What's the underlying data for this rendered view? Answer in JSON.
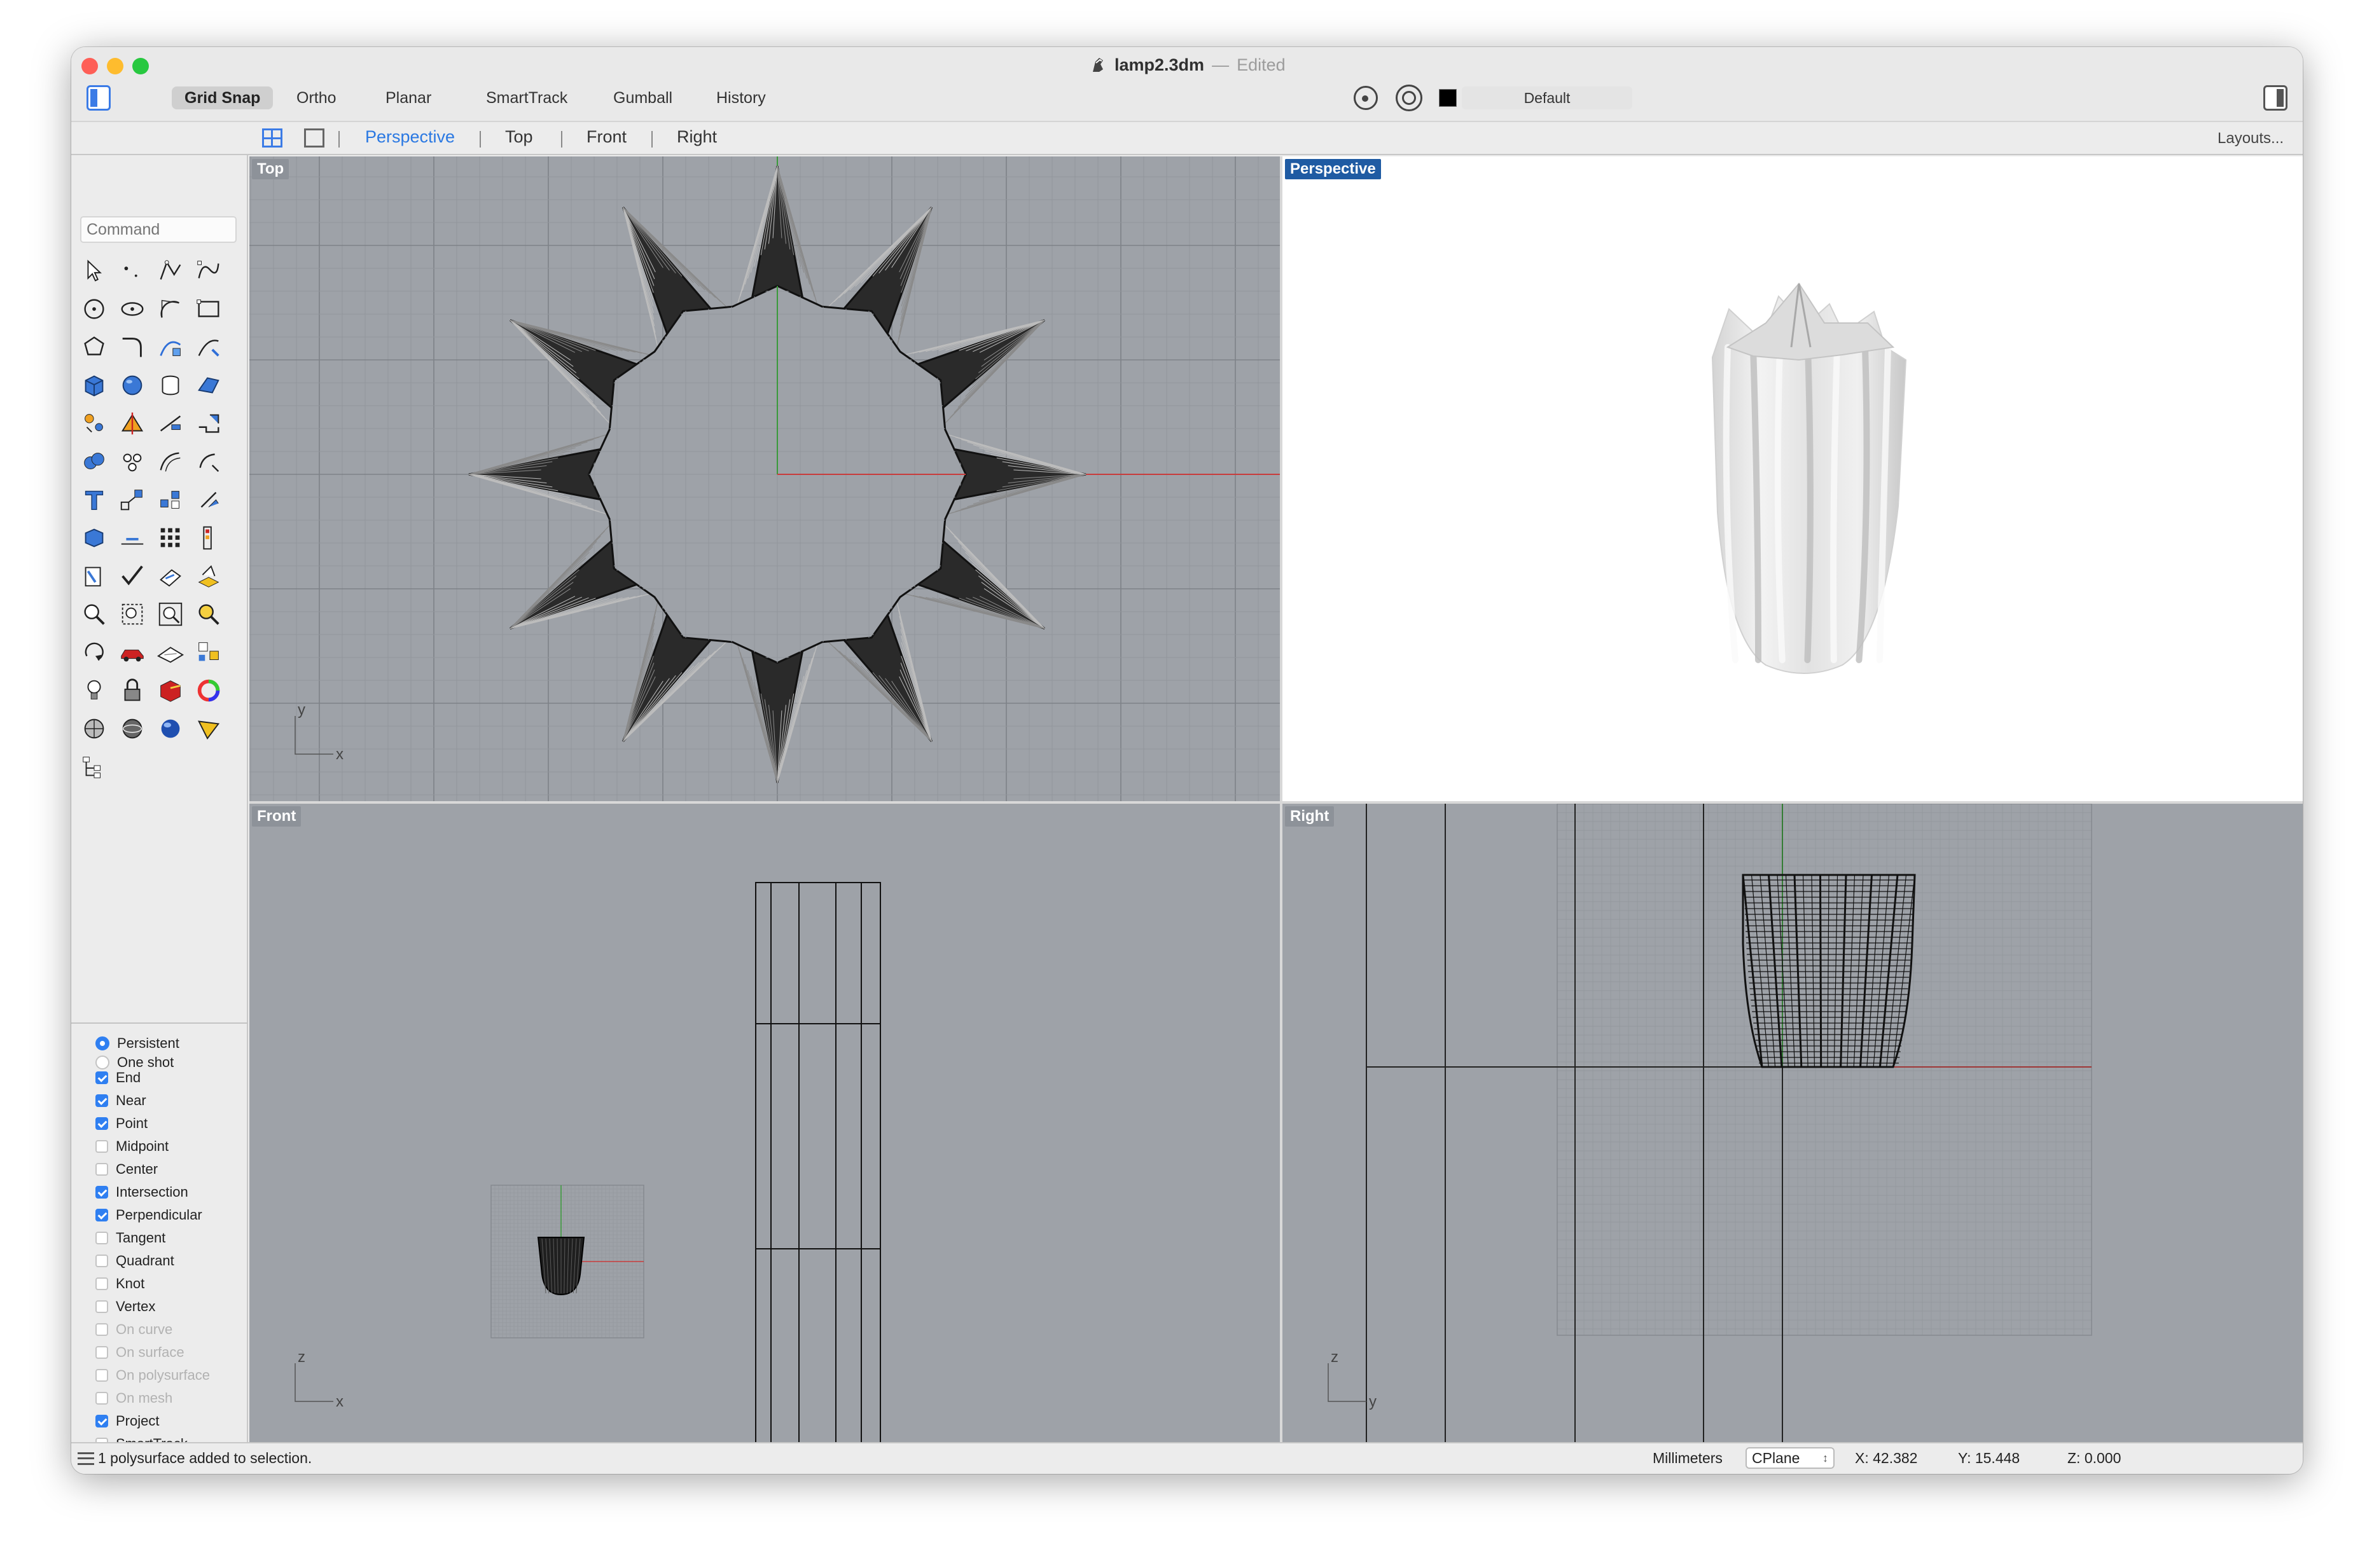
{
  "window": {
    "file_name": "lamp2.3dm",
    "separator": "—",
    "status": "Edited"
  },
  "toolbar": {
    "modes": [
      {
        "label": "Grid Snap",
        "active": true
      },
      {
        "label": "Ortho",
        "active": false
      },
      {
        "label": "Planar",
        "active": false
      },
      {
        "label": "SmartTrack",
        "active": false
      },
      {
        "label": "Gumball",
        "active": false
      },
      {
        "label": "History",
        "active": false
      }
    ],
    "layer": {
      "name": "Default",
      "color": "#000000"
    }
  },
  "tabbar": {
    "tabs": [
      {
        "label": "Perspective",
        "active": true
      },
      {
        "label": "Top",
        "active": false
      },
      {
        "label": "Front",
        "active": false
      },
      {
        "label": "Right",
        "active": false
      }
    ],
    "layouts_label": "Layouts..."
  },
  "command": {
    "placeholder": "Command"
  },
  "tools": [
    "select-arrow",
    "point",
    "polyline",
    "curve",
    "circle",
    "ellipse",
    "arc",
    "rectangle",
    "polygon",
    "fillet-curves",
    "rebuild-curve",
    "extend",
    "box",
    "sphere",
    "cylinder",
    "surface",
    "explode",
    "split",
    "trim",
    "join",
    "boolean-union",
    "group",
    "offset",
    "move-rotate",
    "text",
    "scale",
    "array",
    "gumball",
    "block",
    "dimension",
    "grid-array",
    "history",
    "analyze",
    "check",
    "section",
    "layers",
    "zoom",
    "zoom-window",
    "zoom-extents",
    "zoom-selected",
    "rotate-view",
    "car-render",
    "plane",
    "snapshots",
    "light",
    "lock",
    "material",
    "color-wheel",
    "shaded",
    "rendered",
    "sphere-render",
    "viewport-cone",
    "hierarchy"
  ],
  "snap_panel": {
    "mode_options": [
      {
        "label": "Persistent",
        "selected": true
      },
      {
        "label": "One shot",
        "selected": false
      }
    ],
    "osnaps": [
      {
        "label": "End",
        "checked": true,
        "enabled": true
      },
      {
        "label": "Near",
        "checked": true,
        "enabled": true
      },
      {
        "label": "Point",
        "checked": true,
        "enabled": true
      },
      {
        "label": "Midpoint",
        "checked": false,
        "enabled": true
      },
      {
        "label": "Center",
        "checked": false,
        "enabled": true
      },
      {
        "label": "Intersection",
        "checked": true,
        "enabled": true
      },
      {
        "label": "Perpendicular",
        "checked": true,
        "enabled": true
      },
      {
        "label": "Tangent",
        "checked": false,
        "enabled": true
      },
      {
        "label": "Quadrant",
        "checked": false,
        "enabled": true
      },
      {
        "label": "Knot",
        "checked": false,
        "enabled": true
      },
      {
        "label": "Vertex",
        "checked": false,
        "enabled": true
      },
      {
        "label": "On curve",
        "checked": false,
        "enabled": false
      },
      {
        "label": "On surface",
        "checked": false,
        "enabled": false
      },
      {
        "label": "On polysurface",
        "checked": false,
        "enabled": false
      },
      {
        "label": "On mesh",
        "checked": false,
        "enabled": false
      },
      {
        "label": "Project",
        "checked": true,
        "enabled": true
      },
      {
        "label": "SmartTrack",
        "checked": false,
        "enabled": true
      }
    ]
  },
  "viewports": {
    "top": {
      "label": "Top",
      "active": false,
      "axis_v": "y",
      "axis_h": "x"
    },
    "perspective": {
      "label": "Perspective",
      "active": true
    },
    "front": {
      "label": "Front",
      "active": false,
      "axis_v": "z",
      "axis_h": "x"
    },
    "right": {
      "label": "Right",
      "active": false,
      "axis_v": "z",
      "axis_h": "y"
    }
  },
  "statusbar": {
    "message": "1 polysurface added to selection.",
    "units": "Millimeters",
    "cplane": "CPlane",
    "x": "X: 42.382",
    "y": "Y: 15.448",
    "z": "Z: 0.000"
  }
}
